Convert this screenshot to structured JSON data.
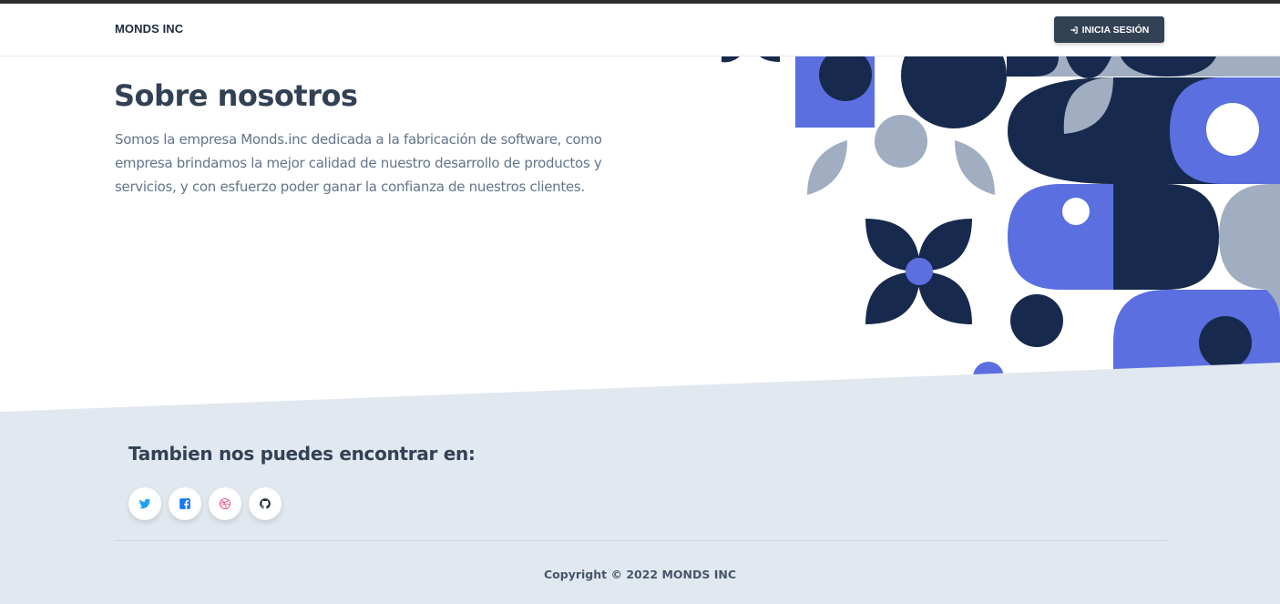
{
  "navbar": {
    "brand": "MONDS INC",
    "login_icon": "sign-in-icon",
    "login_label": "INICIA SESIÓN"
  },
  "hero": {
    "title": "Sobre nosotros",
    "description": "Somos la empresa Monds.inc dedicada a la fabricación de software, como empresa brindamos la mejor calidad de nuestro desarrollo de productos y servicios, y con esfuerzo poder ganar la confianza de nuestros clientes."
  },
  "footer": {
    "find_us_title": "Tambien nos puedes encontrar en:",
    "socials": [
      {
        "name": "twitter",
        "icon": "twitter-icon",
        "color": "#1da1f2"
      },
      {
        "name": "facebook",
        "icon": "facebook-icon",
        "color": "#1877f2"
      },
      {
        "name": "dribbble",
        "icon": "dribbble-icon",
        "color": "#ea4c89"
      },
      {
        "name": "github",
        "icon": "github-icon",
        "color": "#1e293b"
      }
    ],
    "copyright": "Copyright © 2022 MONDS INC"
  },
  "colors": {
    "navy": "#172a4d",
    "indigo": "#5b6fe0",
    "slate": "#a1adc0",
    "footer_bg": "#e2e8f0",
    "button_bg": "#334155"
  }
}
